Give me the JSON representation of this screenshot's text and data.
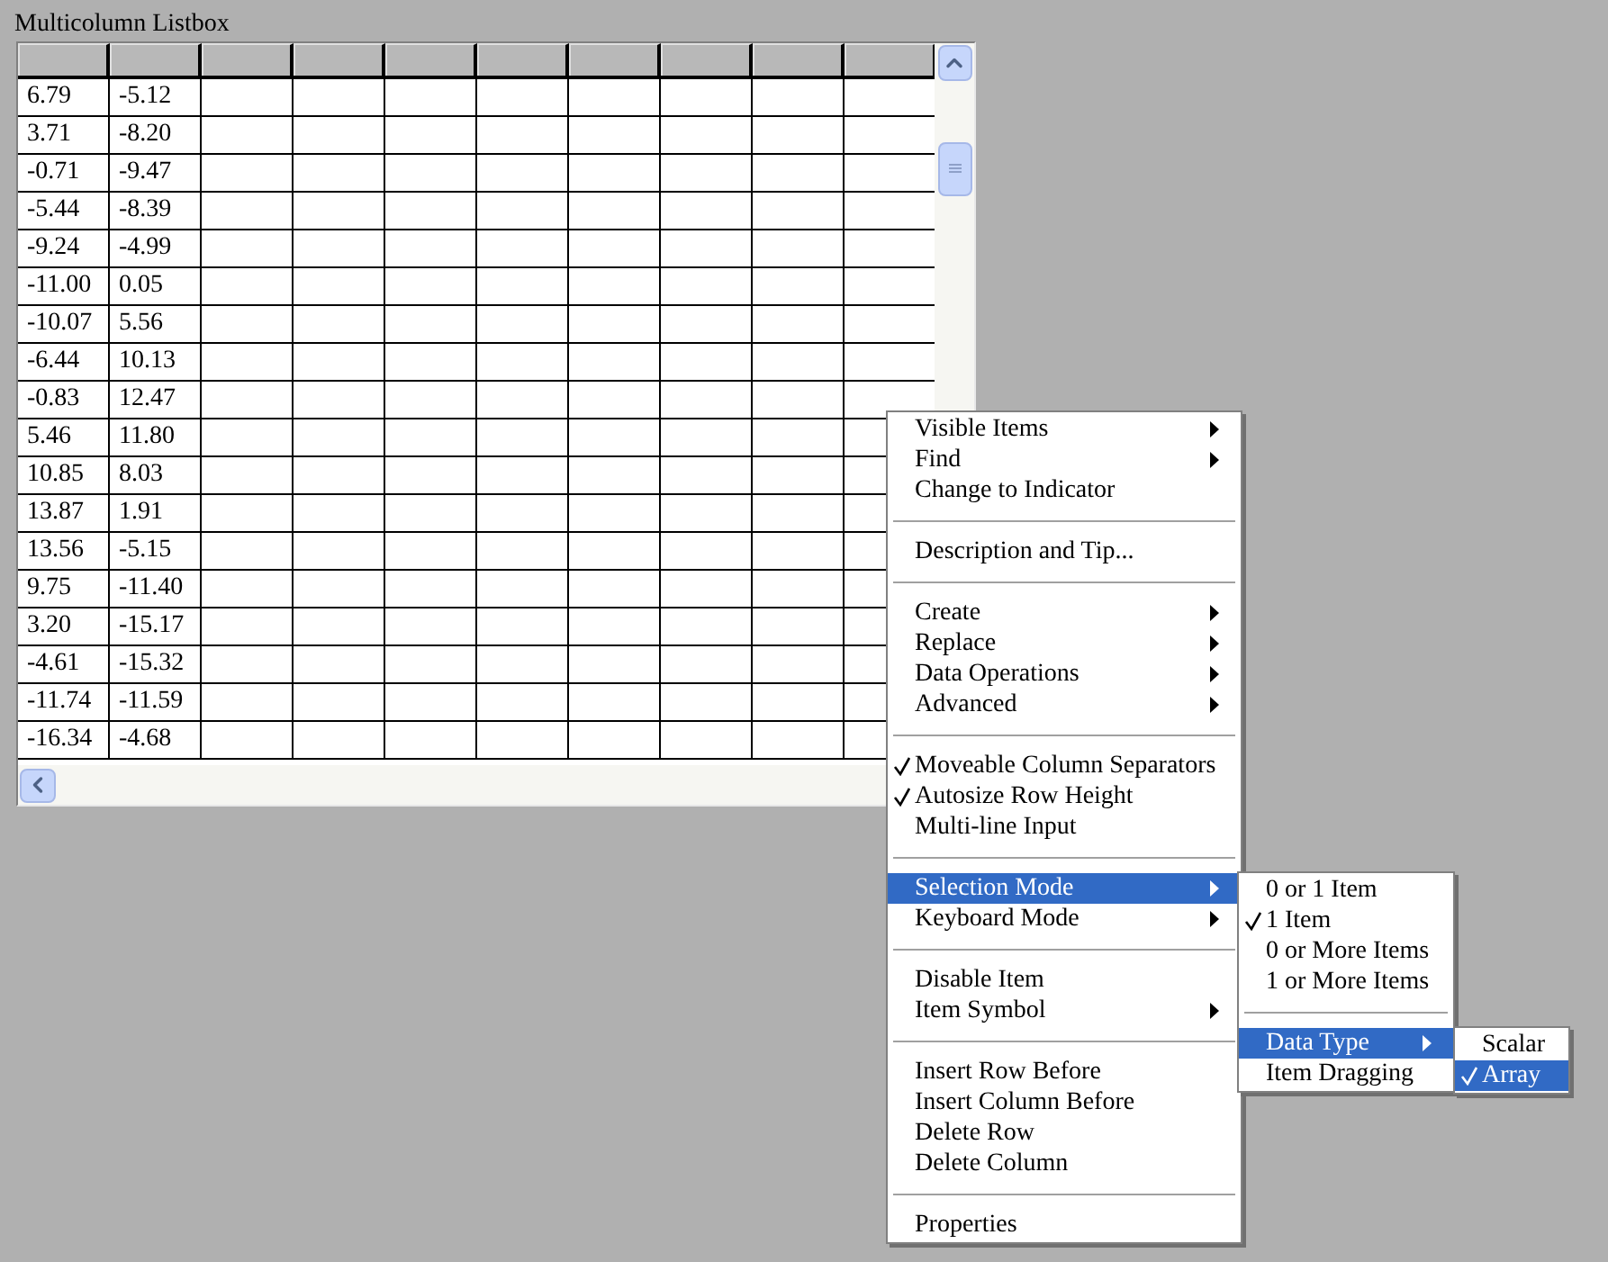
{
  "listbox": {
    "label": "Multicolumn Listbox",
    "rows": [
      [
        "6.79",
        "-5.12"
      ],
      [
        "3.71",
        "-8.20"
      ],
      [
        "-0.71",
        "-9.47"
      ],
      [
        "-5.44",
        "-8.39"
      ],
      [
        "-9.24",
        "-4.99"
      ],
      [
        "-11.00",
        "0.05"
      ],
      [
        "-10.07",
        "5.56"
      ],
      [
        "-6.44",
        "10.13"
      ],
      [
        "-0.83",
        "12.47"
      ],
      [
        "5.46",
        "11.80"
      ],
      [
        "10.85",
        "8.03"
      ],
      [
        "13.87",
        "1.91"
      ],
      [
        "13.56",
        "-5.15"
      ],
      [
        "9.75",
        "-11.40"
      ],
      [
        "3.20",
        "-15.17"
      ],
      [
        "-4.61",
        "-15.32"
      ],
      [
        "-11.74",
        "-11.59"
      ],
      [
        "-16.34",
        "-4.68"
      ]
    ]
  },
  "context_menu": {
    "items": [
      {
        "kind": "item",
        "label": "Visible Items",
        "submenu": true,
        "checked": false,
        "selected": false
      },
      {
        "kind": "item",
        "label": "Find",
        "submenu": true,
        "checked": false,
        "selected": false
      },
      {
        "kind": "item",
        "label": "Change to Indicator",
        "submenu": false,
        "checked": false,
        "selected": false
      },
      {
        "kind": "separator"
      },
      {
        "kind": "item",
        "label": "Description and Tip...",
        "submenu": false,
        "checked": false,
        "selected": false
      },
      {
        "kind": "separator"
      },
      {
        "kind": "item",
        "label": "Create",
        "submenu": true,
        "checked": false,
        "selected": false
      },
      {
        "kind": "item",
        "label": "Replace",
        "submenu": true,
        "checked": false,
        "selected": false
      },
      {
        "kind": "item",
        "label": "Data Operations",
        "submenu": true,
        "checked": false,
        "selected": false
      },
      {
        "kind": "item",
        "label": "Advanced",
        "submenu": true,
        "checked": false,
        "selected": false
      },
      {
        "kind": "separator"
      },
      {
        "kind": "item",
        "label": "Moveable Column Separators",
        "submenu": false,
        "checked": true,
        "selected": false
      },
      {
        "kind": "item",
        "label": "Autosize Row Height",
        "submenu": false,
        "checked": true,
        "selected": false
      },
      {
        "kind": "item",
        "label": "Multi-line Input",
        "submenu": false,
        "checked": false,
        "selected": false
      },
      {
        "kind": "separator"
      },
      {
        "kind": "item",
        "label": "Selection Mode",
        "submenu": true,
        "checked": false,
        "selected": true
      },
      {
        "kind": "item",
        "label": "Keyboard Mode",
        "submenu": true,
        "checked": false,
        "selected": false
      },
      {
        "kind": "separator"
      },
      {
        "kind": "item",
        "label": "Disable Item",
        "submenu": false,
        "checked": false,
        "selected": false
      },
      {
        "kind": "item",
        "label": "Item Symbol",
        "submenu": true,
        "checked": false,
        "selected": false
      },
      {
        "kind": "separator"
      },
      {
        "kind": "item",
        "label": "Insert Row Before",
        "submenu": false,
        "checked": false,
        "selected": false
      },
      {
        "kind": "item",
        "label": "Insert Column Before",
        "submenu": false,
        "checked": false,
        "selected": false
      },
      {
        "kind": "item",
        "label": "Delete Row",
        "submenu": false,
        "checked": false,
        "selected": false
      },
      {
        "kind": "item",
        "label": "Delete Column",
        "submenu": false,
        "checked": false,
        "selected": false
      },
      {
        "kind": "separator"
      },
      {
        "kind": "item",
        "label": "Properties",
        "submenu": false,
        "checked": false,
        "selected": false
      }
    ]
  },
  "selection_submenu": {
    "items": [
      {
        "kind": "item",
        "label": "0 or 1 Item",
        "submenu": false,
        "checked": false,
        "selected": false
      },
      {
        "kind": "item",
        "label": "1 Item",
        "submenu": false,
        "checked": true,
        "selected": false
      },
      {
        "kind": "item",
        "label": "0 or More Items",
        "submenu": false,
        "checked": false,
        "selected": false
      },
      {
        "kind": "item",
        "label": "1 or More Items",
        "submenu": false,
        "checked": false,
        "selected": false
      },
      {
        "kind": "separator"
      },
      {
        "kind": "item",
        "label": "Data Type",
        "submenu": true,
        "checked": false,
        "selected": true
      },
      {
        "kind": "item",
        "label": "Item Dragging",
        "submenu": false,
        "checked": false,
        "selected": false
      }
    ]
  },
  "data_type_submenu": {
    "items": [
      {
        "kind": "item",
        "label": "Scalar",
        "submenu": false,
        "checked": false,
        "selected": false
      },
      {
        "kind": "item",
        "label": "Array",
        "submenu": false,
        "checked": true,
        "selected": true
      }
    ]
  }
}
